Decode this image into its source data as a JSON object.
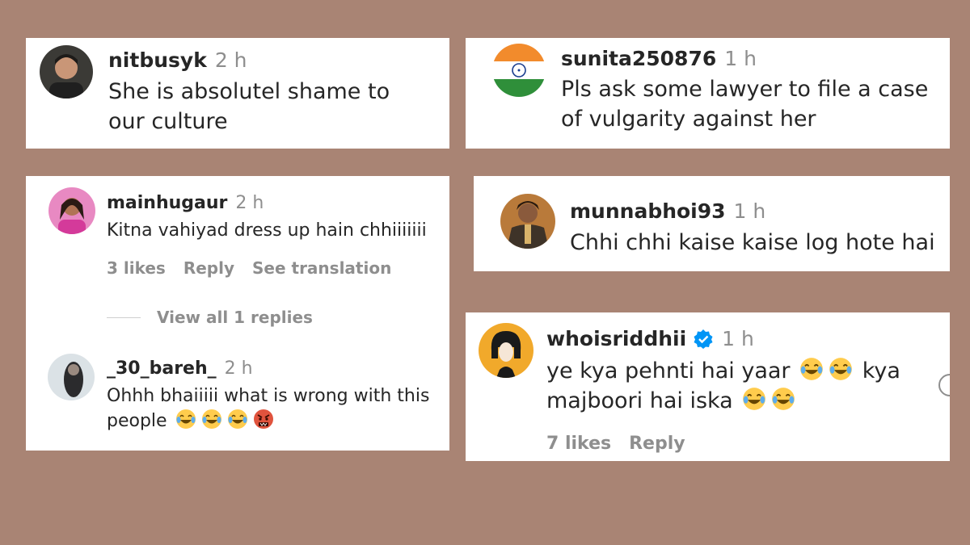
{
  "comments": [
    {
      "username": "nitbusyk",
      "time": "2 h",
      "text": "She is absolutel shame to our culture"
    },
    {
      "username": "sunita250876",
      "time": "1 h",
      "text": "Pls ask some lawyer to file a case of vulgarity against her"
    },
    {
      "username": "mainhugaur",
      "time": "2 h",
      "text": "Kitna vahiyad dress up hain chhiiiiiii",
      "likes": "3 likes",
      "reply": "Reply",
      "translate": "See translation"
    },
    {
      "view_replies": "View all 1 replies"
    },
    {
      "username": "_30_bareh_",
      "time": "2 h",
      "text": "Ohhh bhaiiiii what is wrong with this people"
    },
    {
      "username": "munnabhoi93",
      "time": "1 h",
      "text": "Chhi chhi kaise kaise log hote hai"
    },
    {
      "username": "whoisriddhii",
      "time": "1 h",
      "text_line1": "ye kya pehnti hai yaar",
      "text_kya": "kya",
      "text_line2": "majboori hai iska",
      "likes": "7 likes",
      "reply": "Reply"
    }
  ],
  "icons": {
    "laugh": "face-with-tears-of-joy-icon",
    "angry": "angry-face-icon",
    "verified": "verified-badge-icon"
  },
  "colors": {
    "background": "#a98474",
    "verified": "#0095f6",
    "muted": "#8e8e8e"
  }
}
